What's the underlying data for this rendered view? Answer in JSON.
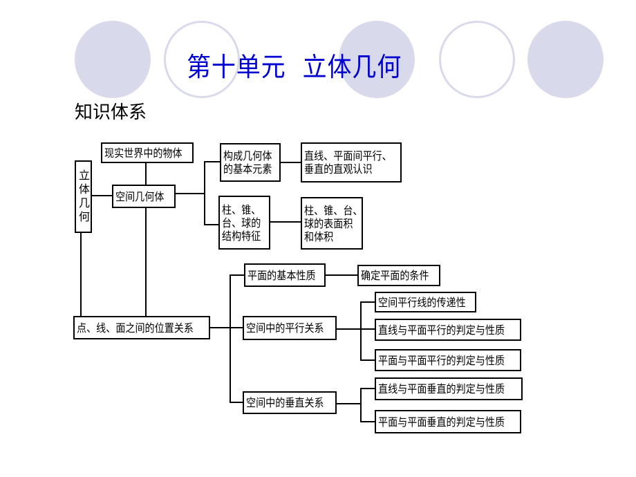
{
  "decoration": {
    "circle_color": "#d9d9ec",
    "circles": [
      "filled",
      "outline",
      "filled",
      "outline",
      "filled"
    ]
  },
  "header": {
    "title": "第十单元  立体几何",
    "title_color": "#0000d0",
    "subtitle": "知识体系"
  },
  "diagram": {
    "root": "立体几何",
    "nodes": {
      "real_world_objects": "现实世界中的物体",
      "spatial_solids": "空间几何体",
      "basic_elements": "构成几何体\n的基本元素",
      "intuitive_understanding": "直线、平面间平行、\n垂直的直观认识",
      "structure_features": "柱、锥、\n台、球的\n结构特征",
      "area_volume": "柱、锥、台、\n球的表面积\n和体积",
      "position_relations": "点、线、面之间的位置关系",
      "plane_basic_properties": "平面的基本性质",
      "plane_determination": "确定平面的条件",
      "parallel_relations": "空间中的平行关系",
      "parallel_transitivity": "空间平行线的传递性",
      "line_plane_parallel": "直线与平面平行的判定与性质",
      "plane_plane_parallel": "平面与平面平行的判定与性质",
      "perpendicular_relations": "空间中的垂直关系",
      "line_plane_perpendicular": "直线与平面垂直的判定与性质",
      "plane_plane_perpendicular": "平面与平面垂直的判定与性质"
    }
  }
}
